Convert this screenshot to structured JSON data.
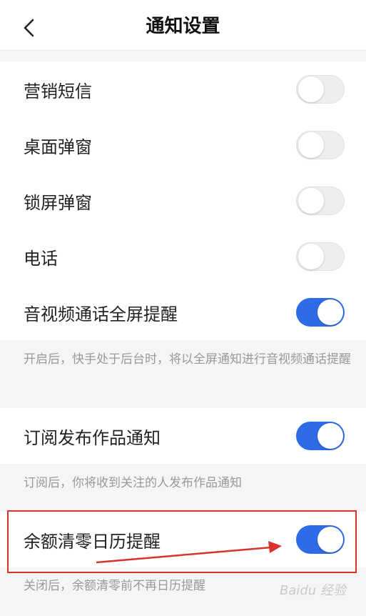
{
  "header": {
    "title": "通知设置",
    "back_icon": "chevron-left-icon"
  },
  "settings": [
    {
      "label": "营销短信",
      "enabled": false
    },
    {
      "label": "桌面弹窗",
      "enabled": false
    },
    {
      "label": "锁屏弹窗",
      "enabled": false
    },
    {
      "label": "电话",
      "enabled": false
    },
    {
      "label": "音视频通话全屏提醒",
      "enabled": true
    }
  ],
  "av_note": "开启后，快手处于后台时，将以全屏通知进行音视频通话提醒",
  "subscribe": {
    "label": "订阅发布作品通知",
    "enabled": true,
    "note": "订阅后，你将收到关注的人发布作品通知"
  },
  "balance": {
    "label": "余额清零日历提醒",
    "enabled": true,
    "note": "关闭后，余额清零前不再日历提醒"
  },
  "watermark": "Baidu 经验",
  "colors": {
    "toggle_on": "#2e6be6",
    "toggle_off": "#eeeeee",
    "annotation": "#d9342b"
  }
}
